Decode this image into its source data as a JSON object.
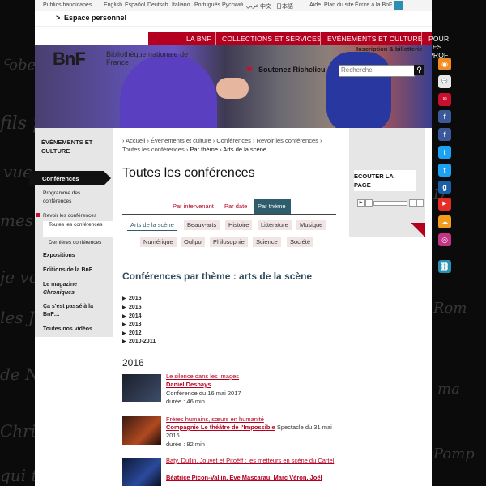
{
  "lang_bar": {
    "handicap": "Publics handicapés",
    "langs": [
      "English",
      "Español",
      "Deutsch",
      "Italiano",
      "Português",
      "Русский",
      "عربي",
      "中文",
      "日本語"
    ],
    "aide": "Aide",
    "plan": "Plan du site",
    "ecrire": "Écrire à la BnF"
  },
  "espace": {
    "arrow": ">",
    "label": "Espace personnel"
  },
  "nav": {
    "items": [
      "LA BNF",
      "COLLECTIONS ET SERVICES",
      "ÉVÉNEMENTS ET CULTURE",
      "POUR LES PROF"
    ]
  },
  "banner": {
    "logo": "BnF",
    "logo_sub": "Bibliothèque nationale de France",
    "soutenez": "Soutenez Richelieu",
    "inscription": "Inscription & billetterie",
    "search_placeholder": "Recherche"
  },
  "sidebar": {
    "title": "ÉVÉNEMENTS ET CULTURE",
    "active": "Conférences",
    "programme": "Programme des conférences",
    "revoir": "Revoir les conférences",
    "toutes": "Toutes les conférences",
    "dernieres": "Dernières conférences",
    "expositions": "Expositions",
    "editions": "Éditions de la BnF",
    "magazine": "Le magazine",
    "chroniques": "Chroniques",
    "passe": "Ça s'est passé à la BnF…",
    "videos": "Toutes nos vidéos"
  },
  "breadcrumb": {
    "items": [
      "Accueil",
      "Événements et culture",
      "Conférences",
      "Revoir les conférences",
      "Toutes les conférences",
      "Par thème"
    ],
    "current": "Arts de la scène"
  },
  "page_title": "Toutes les conférences",
  "tabs": {
    "intervenant": "Par intervenant",
    "date": "Par date",
    "theme": "Par thème"
  },
  "themes": [
    "Arts de la scène",
    "Beaux-arts",
    "Histoire",
    "Littérature",
    "Musique",
    "Numérique",
    "Oulipo",
    "Philosophie",
    "Science",
    "Société"
  ],
  "section_title": "Conférences par thème : arts de la scène",
  "years": [
    "2016",
    "2015",
    "2014",
    "2013",
    "2012",
    "2010-2011"
  ],
  "year_heading": "2016",
  "conferences": [
    {
      "title": "Le silence dans les images",
      "author": "Daniel Deshays",
      "date": "Conférence du 16 mai 2017",
      "duration": "durée : 46 min"
    },
    {
      "title": "Frères humains, sœurs en humanité",
      "author": "Compagnie Le théâtre de l'Impossible",
      "date": "Spectacle du 31 mai 2016",
      "duration": "durée : 82 min"
    },
    {
      "title": "Baty, Dullin, Jouvet et Pitoëff : les metteurs en scène du Cartel",
      "author": "Béatrice Picon-Vallin, Eve Mascarau, Marc Véron, Joël"
    }
  ],
  "listen": {
    "label": "ÉCOUTER LA PAGE"
  },
  "social_icons": [
    "rss-icon",
    "blogs-icon",
    "lettre-icon",
    "facebook-icon",
    "facebook-icon",
    "twitter-icon",
    "twitter-icon",
    "gallica-icon",
    "youtube-icon",
    "soundcloud-icon",
    "instagram-icon",
    "link-icon"
  ],
  "colors": {
    "brand_red": "#b4001e",
    "teal": "#2f5d6e"
  }
}
